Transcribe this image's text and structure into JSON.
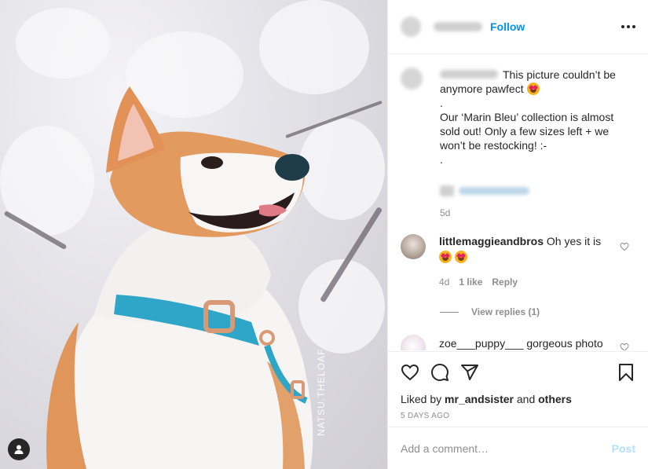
{
  "post": {
    "photo": {
      "watermark": "NATSU.THELOAF",
      "tag_icon": "user-tag-icon"
    },
    "header": {
      "follow_label": "Follow",
      "more_icon": "more-options-icon"
    },
    "caption": {
      "text_line1": "This picture couldn’t be anymore pawfect",
      "body": ".\nOur ‘Marin Bleu’ collection is almost sold out! Only a few sizes left + we won’t be restocking! :-\n.",
      "age": "5d"
    },
    "comments": [
      {
        "username": "littlemaggieandbros",
        "text": "Oh yes it is",
        "age": "4d",
        "likes": "1 like",
        "reply_label": "Reply",
        "view_replies": "View replies (1)",
        "avatar_color": "#b7a89c"
      },
      {
        "username": "zoe___puppy___",
        "text": "gorgeous photo",
        "avatar_color": "#f2e6ee"
      }
    ],
    "actions": {
      "like_icon": "heart-icon",
      "comment_icon": "comment-icon",
      "share_icon": "share-icon",
      "save_icon": "bookmark-icon",
      "liked_by_prefix": "Liked by",
      "liked_by_user": "mr_andsister",
      "liked_by_and": "and",
      "liked_by_others": "others",
      "date": "5 DAYS AGO"
    },
    "add_comment": {
      "placeholder": "Add a comment…",
      "post_label": "Post"
    },
    "colors": {
      "accent": "#0095f6",
      "post_disabled": "#b2dffc",
      "muted": "#8e8e8e",
      "collar": "#2fa6c8"
    }
  }
}
